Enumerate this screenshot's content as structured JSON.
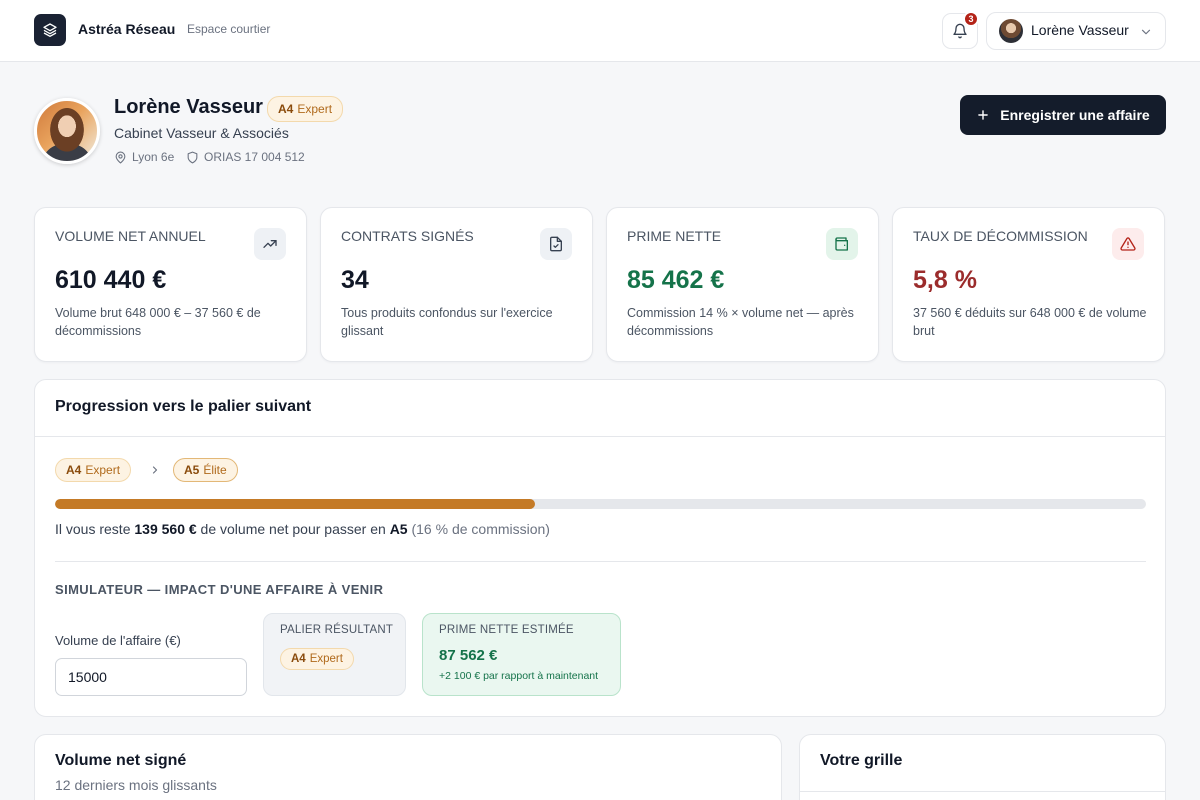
{
  "header": {
    "brand": "Astréa Réseau",
    "brand_sub": "Espace courtier",
    "notification_count": "3",
    "user_name": "Lorène Vasseur"
  },
  "profile": {
    "name": "Lorène Vasseur",
    "tier_code": "A4",
    "tier_name": "Expert",
    "cabinet": "Cabinet Vasseur & Associés",
    "location": "Lyon 6e",
    "orias": "ORIAS 17 004 512",
    "cta_label": "Enregistrer une affaire"
  },
  "kpis": [
    {
      "label": "VOLUME NET ANNUEL",
      "value": "610 440 €",
      "desc": "Volume brut 648 000 € – 37 560 € de décommissions",
      "icon": "trending-up-icon",
      "value_color": "#111827",
      "icon_bg": "#eef1f5",
      "icon_color": "#374151"
    },
    {
      "label": "CONTRATS SIGNÉS",
      "value": "34",
      "desc": "Tous produits confondus sur l'exercice glissant",
      "icon": "file-check-icon",
      "value_color": "#111827",
      "icon_bg": "#eef1f5",
      "icon_color": "#374151"
    },
    {
      "label": "PRIME NETTE",
      "value": "85 462 €",
      "desc": "Commission 14 % × volume net — après décommissions",
      "icon": "wallet-icon",
      "value_color": "#15734a",
      "icon_bg": "#e3f4ea",
      "icon_color": "#15734a"
    },
    {
      "label": "TAUX DE DÉCOMMISSION",
      "value": "5,8 %",
      "desc": "37 560 € déduits sur 648 000 € de volume brut",
      "icon": "alert-triangle-icon",
      "value_color": "#9b2c2c",
      "icon_bg": "#fdecec",
      "icon_color": "#b42318"
    }
  ],
  "progression": {
    "title": "Progression vers le palier suivant",
    "from_code": "A4",
    "from_name": "Expert",
    "to_code": "A5",
    "to_name": "Élite",
    "progress_fraction": 0.44,
    "text_prefix": "Il vous reste ",
    "remaining": "139 560 €",
    "text_middle": " de volume net pour passer en ",
    "next_tier": "A5",
    "text_suffix": " (16 % de commission)",
    "simulator_title": "SIMULATEUR — IMPACT D'UNE AFFAIRE À VENIR",
    "input_label": "Volume de l'affaire (€)",
    "input_value": "15000",
    "result_tier_label": "PALIER RÉSULTANT",
    "result_tier_code": "A4",
    "result_tier_name": "Expert",
    "prime_label": "PRIME NETTE ESTIMÉE",
    "prime_value": "87 562 €",
    "prime_delta": "+2 100 € par rapport à maintenant"
  },
  "bottom": {
    "left_title": "Volume net signé",
    "left_sub": "12 derniers mois glissants",
    "right_title": "Votre grille"
  },
  "colors": {
    "accent": "#c47a26",
    "cta": "#141c2b",
    "positive": "#15734a",
    "negative": "#9b2c2c"
  }
}
